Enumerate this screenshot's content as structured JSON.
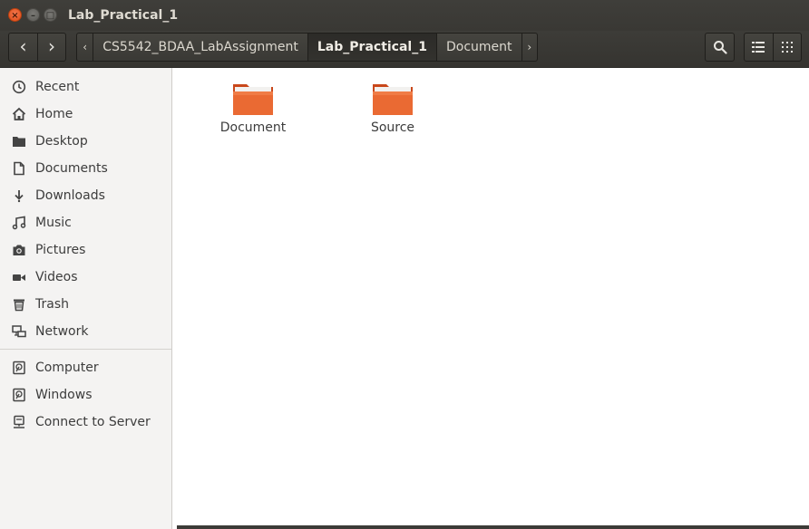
{
  "window": {
    "title": "Lab_Practical_1",
    "close_glyph": "×",
    "min_glyph": "–",
    "max_glyph": "□"
  },
  "toolbar": {
    "back_glyph": "‹",
    "forward_glyph": "›",
    "path_left_arrow": "‹",
    "path_right_arrow": "›",
    "breadcrumbs": [
      {
        "label": "CS5542_BDAA_LabAssignment",
        "active": false
      },
      {
        "label": "Lab_Practical_1",
        "active": true
      },
      {
        "label": "Document",
        "active": false
      }
    ]
  },
  "sidebar": {
    "places": [
      {
        "label": "Recent",
        "icon": "clock-icon"
      },
      {
        "label": "Home",
        "icon": "home-icon"
      },
      {
        "label": "Desktop",
        "icon": "desktop-folder-icon"
      },
      {
        "label": "Documents",
        "icon": "document-icon"
      },
      {
        "label": "Downloads",
        "icon": "download-icon"
      },
      {
        "label": "Music",
        "icon": "music-icon"
      },
      {
        "label": "Pictures",
        "icon": "camera-icon"
      },
      {
        "label": "Videos",
        "icon": "video-icon"
      },
      {
        "label": "Trash",
        "icon": "trash-icon"
      },
      {
        "label": "Network",
        "icon": "network-icon"
      }
    ],
    "devices": [
      {
        "label": "Computer",
        "icon": "drive-icon"
      },
      {
        "label": "Windows",
        "icon": "drive-icon"
      },
      {
        "label": "Connect to Server",
        "icon": "server-icon"
      }
    ]
  },
  "main": {
    "files": [
      {
        "name": "Document",
        "icon": "folder-icon"
      },
      {
        "name": "Source",
        "icon": "folder-icon"
      }
    ]
  },
  "colors": {
    "accent_close": "#df4a16",
    "folder_orange": "#e8612c",
    "chrome_dark": "#3c3b37"
  }
}
